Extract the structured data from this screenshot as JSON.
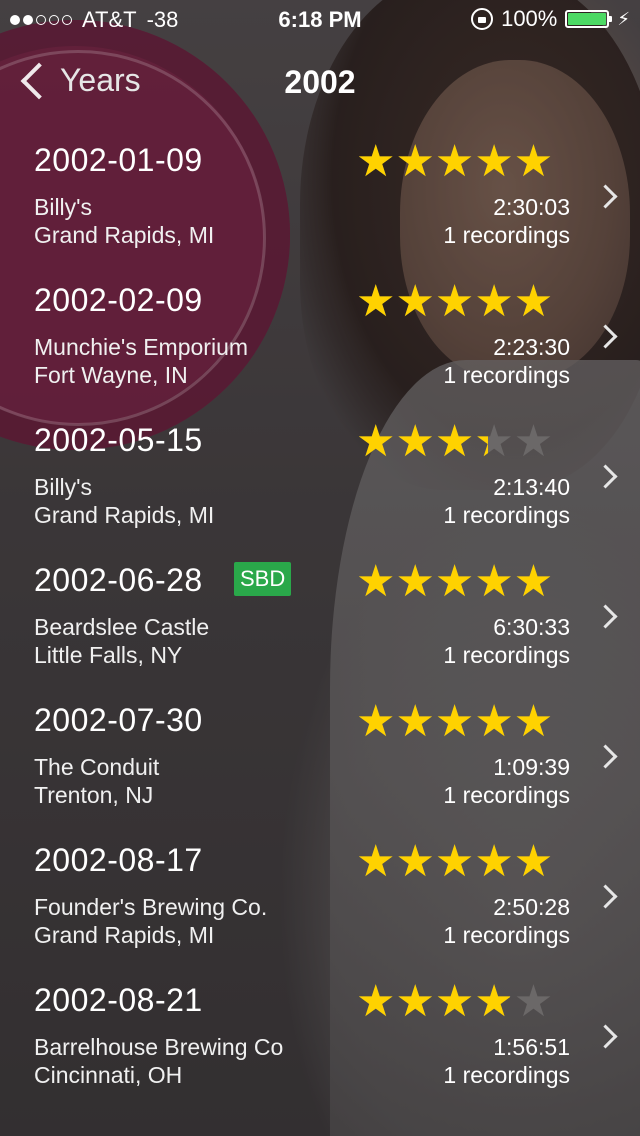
{
  "status_bar": {
    "carrier": "AT&T",
    "signal_dbm": "-38",
    "time": "6:18 PM",
    "battery": "100%",
    "signal_dots_on": 2,
    "signal_dots_total": 5
  },
  "nav": {
    "back_label": "Years",
    "title": "2002"
  },
  "colors": {
    "star": "#ffd200",
    "star_empty": "#6b6868",
    "sbd_badge": "#2aa84a",
    "battery_fill": "#4cd964"
  },
  "shows": [
    {
      "date": "2002-01-09",
      "sbd": false,
      "venue": "Billy's",
      "city": "Grand Rapids, MI",
      "duration": "2:30:03",
      "recordings": "1 recordings",
      "rating": 5
    },
    {
      "date": "2002-02-09",
      "sbd": false,
      "venue": "Munchie's Emporium",
      "city": "Fort Wayne, IN",
      "duration": "2:23:30",
      "recordings": "1 recordings",
      "rating": 5
    },
    {
      "date": "2002-05-15",
      "sbd": false,
      "venue": "Billy's",
      "city": "Grand Rapids, MI",
      "duration": "2:13:40",
      "recordings": "1 recordings",
      "rating": 3
    },
    {
      "date": "2002-06-28",
      "sbd": true,
      "sbd_label": "SBD",
      "venue": "Beardslee Castle",
      "city": "Little Falls, NY",
      "duration": "6:30:33",
      "recordings": "1 recordings",
      "rating": 4.6
    },
    {
      "date": "2002-07-30",
      "sbd": false,
      "venue": "The Conduit",
      "city": "Trenton, NJ",
      "duration": "1:09:39",
      "recordings": "1 recordings",
      "rating": 5
    },
    {
      "date": "2002-08-17",
      "sbd": false,
      "venue": "Founder's Brewing Co.",
      "city": "Grand Rapids, MI",
      "duration": "2:50:28",
      "recordings": "1 recordings",
      "rating": 5
    },
    {
      "date": "2002-08-21",
      "sbd": false,
      "venue": "Barrelhouse Brewing Co",
      "city": "Cincinnati, OH",
      "duration": "1:56:51",
      "recordings": "1 recordings",
      "rating": 3.5
    }
  ]
}
